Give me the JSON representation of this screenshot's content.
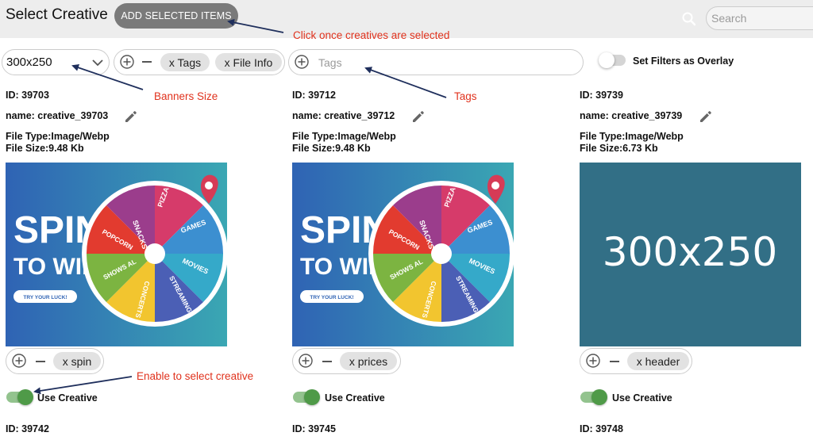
{
  "header": {
    "title": "Select Creative",
    "add_button": "ADD SELECTED ITEMS",
    "search_placeholder": "Search"
  },
  "annotations": {
    "add_button": "Click once creatives are selected",
    "banner_size": "Banners Size",
    "tags": "Tags",
    "enable": "Enable to select creative"
  },
  "filters": {
    "size_value": "300x250",
    "chips": [
      "x Tags",
      "x File Info"
    ],
    "tags_placeholder": "Tags",
    "overlay_label": "Set Filters as Overlay"
  },
  "creatives": [
    {
      "id": "ID: 39703",
      "name": "name: creative_39703",
      "file_type": "File Type:Image/Webp",
      "file_size": "File Size:9.48 Kb",
      "tag": "x spin",
      "use_label": "Use Creative",
      "use_enabled": true
    },
    {
      "id": "ID: 39712",
      "name": "name: creative_39712",
      "file_type": "File Type:Image/Webp",
      "file_size": "File Size:9.48 Kb",
      "tag": "x prices",
      "use_label": "Use Creative",
      "use_enabled": true
    },
    {
      "id": "ID: 39739",
      "name": "name: creative_39739",
      "file_type": "File Type:Image/Webp",
      "file_size": "File Size:6.73 Kb",
      "tag": "x header",
      "use_label": "Use Creative",
      "use_enabled": true
    }
  ],
  "next_ids": [
    "ID: 39742",
    "ID: 39745",
    "ID: 39748"
  ],
  "banner": {
    "spin_line1": "SPIN",
    "spin_line2": "TO WIN",
    "cta": "TRY YOUR LUCK!",
    "wheel_segments": [
      "PIZZA",
      "GAMES",
      "MOVIES",
      "STREAMING",
      "CONCERTS",
      "SHOWS AL",
      "POPCORN",
      "SNACKS"
    ],
    "placeholder_text": "300x250"
  },
  "colors": {
    "accent_red": "#e0321d",
    "toggle_on": "#4f9a48",
    "banner_bg_start": "#2f63b4",
    "banner_bg_end": "#3aa7b3",
    "placeholder_bg": "#326f86"
  }
}
